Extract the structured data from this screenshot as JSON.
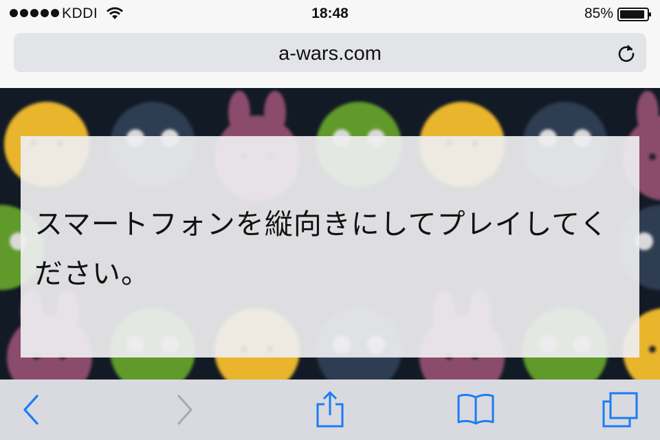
{
  "status_bar": {
    "carrier": "KDDI",
    "time": "18:48",
    "battery": "85%"
  },
  "address_bar": {
    "url": "a-wars.com"
  },
  "content": {
    "message": "スマートフォンを縦向きにしてプレイしてください。"
  },
  "toolbar": {
    "items": [
      "back-icon",
      "forward-icon",
      "share-icon",
      "bookmarks-icon",
      "tabs-icon"
    ]
  },
  "colors": {
    "accent": "#1a7cf6",
    "disabled": "#a9abb0",
    "content_bg": "#121a25"
  }
}
